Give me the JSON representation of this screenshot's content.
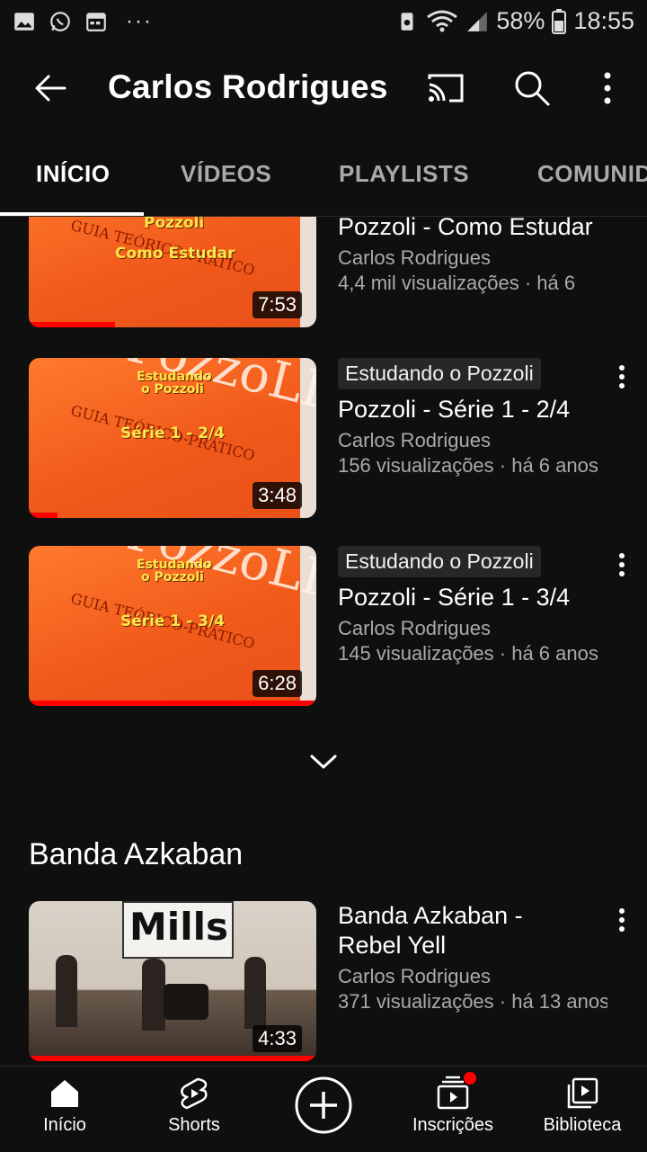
{
  "status_bar": {
    "battery": "58%",
    "time": "18:55"
  },
  "app_bar": {
    "title": "Carlos Rodrigues"
  },
  "tabs": [
    {
      "label": "INÍCIO"
    },
    {
      "label": "VÍDEOS"
    },
    {
      "label": "PLAYLISTS"
    },
    {
      "label": "COMUNID"
    }
  ],
  "videos": [
    {
      "badge": "",
      "title": "Pozzoli - Como Estudar",
      "channel": "Carlos Rodrigues",
      "stats": "4,4 mil visualizações · há 6",
      "duration": "7:53",
      "thumb_line1": "Pozzoli",
      "thumb_line2": "Como Estudar",
      "progress_pct": 30
    },
    {
      "badge": "Estudando o Pozzoli",
      "title": "Pozzoli - Série 1 - 2/4",
      "channel": "Carlos Rodrigues",
      "stats": "156 visualizações · há 6 anos",
      "duration": "3:48",
      "thumb_line1": "Estudando o Pozzoli",
      "thumb_line2": "Série 1 - 2/4",
      "progress_pct": 10
    },
    {
      "badge": "Estudando o Pozzoli",
      "title": "Pozzoli - Série 1 - 3/4",
      "channel": "Carlos Rodrigues",
      "stats": "145 visualizações · há 6 anos",
      "duration": "6:28",
      "thumb_line1": "Estudando o Pozzoli",
      "thumb_line2": "Série 1 - 3/4",
      "progress_pct": 100
    }
  ],
  "section": {
    "title": "Banda Azkaban",
    "video": {
      "title_line1": "Banda Azkaban -",
      "title_line2": "Rebel Yell",
      "channel": "Carlos Rodrigues",
      "stats": "371 visualizações · há 13 anos",
      "duration": "4:33",
      "banner": "Mills",
      "progress_pct": 100
    }
  },
  "bottom_nav": [
    {
      "label": "Início",
      "icon": "home-icon"
    },
    {
      "label": "Shorts",
      "icon": "shorts-icon"
    },
    {
      "label": "",
      "icon": "create-icon"
    },
    {
      "label": "Inscrições",
      "icon": "subscriptions-icon"
    },
    {
      "label": "Biblioteca",
      "icon": "library-icon"
    }
  ],
  "colors": {
    "background": "#0f0f0f",
    "accent": "#ff0000",
    "secondary_text": "#aaaaaa"
  }
}
